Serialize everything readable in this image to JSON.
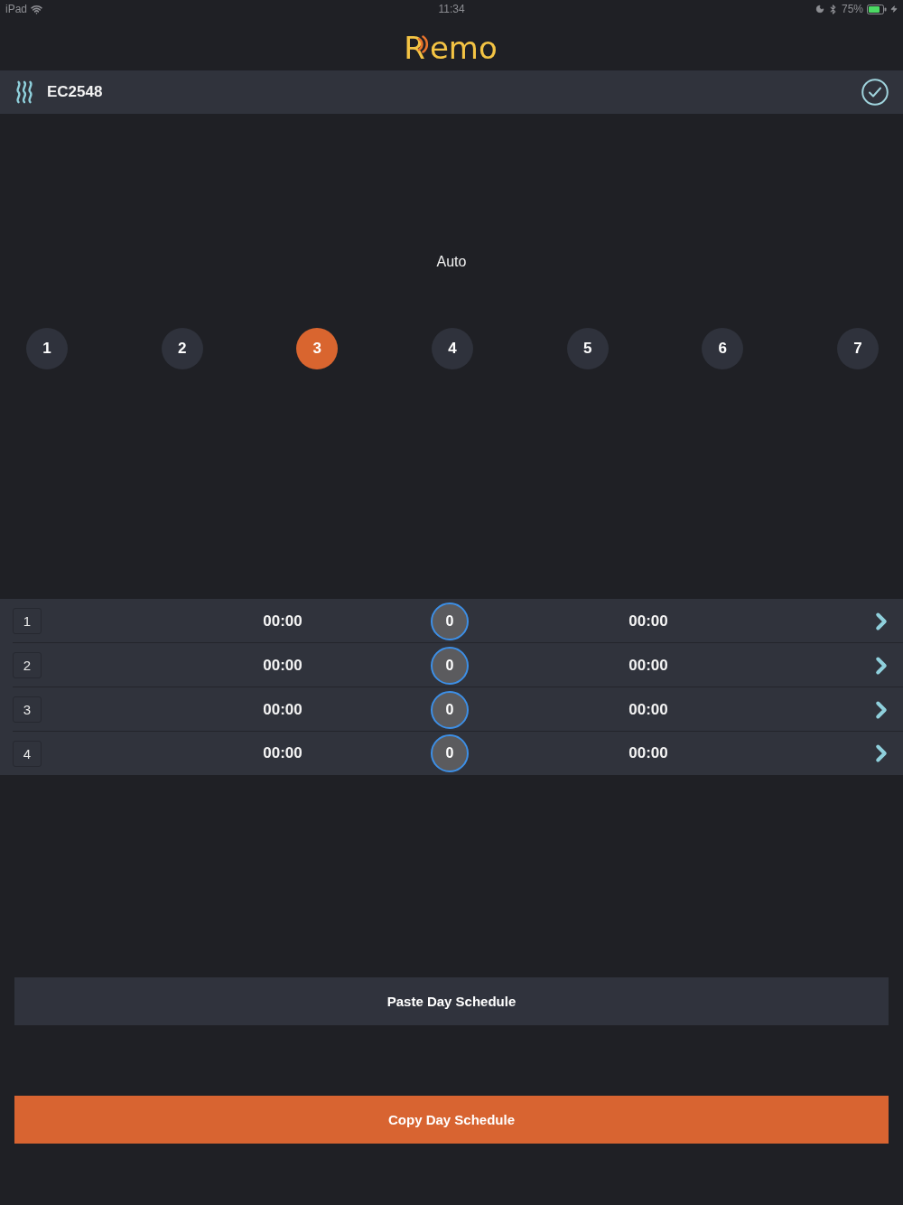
{
  "status_bar": {
    "device": "iPad",
    "time": "11:34",
    "battery": "75%"
  },
  "logo": {
    "text": "Remo"
  },
  "header": {
    "device_id": "EC2548"
  },
  "mode": {
    "label": "Auto"
  },
  "days": [
    {
      "label": "1",
      "selected": false
    },
    {
      "label": "2",
      "selected": false
    },
    {
      "label": "3",
      "selected": true
    },
    {
      "label": "4",
      "selected": false
    },
    {
      "label": "5",
      "selected": false
    },
    {
      "label": "6",
      "selected": false
    },
    {
      "label": "7",
      "selected": false
    }
  ],
  "schedule": {
    "rows": [
      {
        "index": "1",
        "start": "00:00",
        "value": "0",
        "end": "00:00"
      },
      {
        "index": "2",
        "start": "00:00",
        "value": "0",
        "end": "00:00"
      },
      {
        "index": "3",
        "start": "00:00",
        "value": "0",
        "end": "00:00"
      },
      {
        "index": "4",
        "start": "00:00",
        "value": "0",
        "end": "00:00"
      }
    ]
  },
  "buttons": [
    {
      "label": "Paste Day Schedule",
      "kind": "secondary"
    },
    {
      "label": "Copy Day Schedule",
      "kind": "primary"
    }
  ]
}
